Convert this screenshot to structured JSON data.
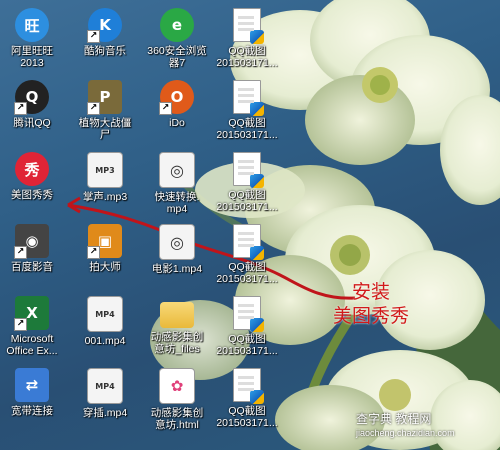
{
  "desktop": {
    "icons": [
      {
        "label": "阿里旺旺\n2013",
        "icon": "aliwangwang-icon",
        "color": "#2d8fe0",
        "glyph": "旺"
      },
      {
        "label": "酷狗音乐",
        "icon": "kugou-icon",
        "color": "#1f7fd8",
        "glyph": "K"
      },
      {
        "label": "360安全浏览\n器7",
        "icon": "browser-360-icon",
        "color": "#2aa845",
        "glyph": "e"
      },
      {
        "label": "QQ截图\n201503171...",
        "icon": "image-file-icon"
      },
      {
        "label": "腾讯QQ",
        "icon": "qq-penguin-icon",
        "color": "#222222",
        "glyph": "Q"
      },
      {
        "label": "植物大战僵\n尸",
        "icon": "plants-vs-zombies-icon",
        "color": "#7a6a3a",
        "glyph": "P"
      },
      {
        "label": "iDo",
        "icon": "ido-icon",
        "color": "#e05a1a",
        "glyph": "O"
      },
      {
        "label": "QQ截图\n201503171...",
        "icon": "image-file-icon"
      },
      {
        "label": "美图秀秀",
        "icon": "meitu-xiuxiu-icon",
        "color": "#e02436",
        "glyph": "秀"
      },
      {
        "label": "掌声.mp3",
        "icon": "mp3-file-icon",
        "glyph": "MP3"
      },
      {
        "label": "快速转换.\nmp4",
        "icon": "video-reel-icon"
      },
      {
        "label": "QQ截图\n201503171...",
        "icon": "image-file-icon"
      },
      {
        "label": "百度影音",
        "icon": "film-reel-icon",
        "color": "#444444",
        "glyph": "◉"
      },
      {
        "label": "拍大师",
        "icon": "camera-icon",
        "color": "#e08a1a",
        "glyph": "▣"
      },
      {
        "label": "电影1.mp4",
        "icon": "video-reel-icon"
      },
      {
        "label": "QQ截图\n201503171...",
        "icon": "image-file-icon"
      },
      {
        "label": "Microsoft\nOffice Ex...",
        "icon": "excel-icon",
        "color": "#1d7a3a",
        "glyph": "X"
      },
      {
        "label": "001.mp4",
        "icon": "mp4-file-icon",
        "glyph": "MP4"
      },
      {
        "label": "动感影集创\n意坊_files",
        "icon": "folder-icon"
      },
      {
        "label": "QQ截图\n201503171...",
        "icon": "image-file-icon"
      },
      {
        "label": "宽带连接",
        "icon": "network-connection-icon",
        "color": "#3a7bd5",
        "glyph": "⇄"
      },
      {
        "label": "穿插.mp4",
        "icon": "mp4-file-icon",
        "glyph": "MP4"
      },
      {
        "label": "动感影集创\n意坊.html",
        "icon": "html-file-icon",
        "color": "#ffffff",
        "glyph": "✿"
      },
      {
        "label": "QQ截图\n201503171...",
        "icon": "image-file-icon"
      }
    ]
  },
  "annotation": {
    "line1": "安装",
    "line2": "美图秀秀",
    "color": "#d11a1a"
  },
  "watermark": {
    "text": "查字典 教程网",
    "sub": "jiaocheng.chazidian.com"
  }
}
